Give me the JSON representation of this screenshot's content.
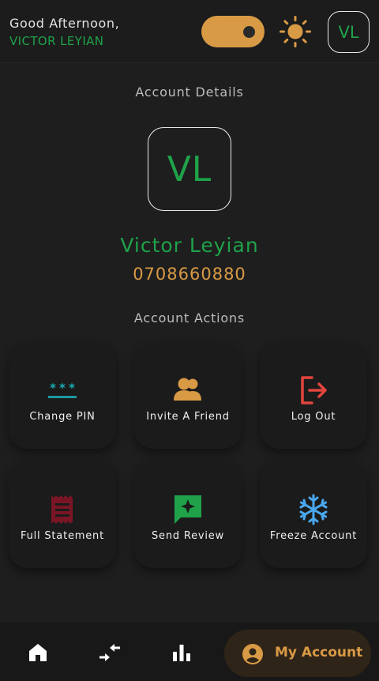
{
  "header": {
    "greeting": "Good Afternoon,",
    "user_name": "VICTOR LEYIAN",
    "avatar_initials": "VL"
  },
  "account": {
    "section_title": "Account Details",
    "avatar_initials": "VL",
    "full_name": "Victor Leyian",
    "phone": "0708660880"
  },
  "actions": {
    "section_title": "Account Actions",
    "items": [
      {
        "label": "Change PIN",
        "icon": "password-icon"
      },
      {
        "label": "Invite A Friend",
        "icon": "group-icon"
      },
      {
        "label": "Log Out",
        "icon": "logout-icon"
      },
      {
        "label": "Full Statement",
        "icon": "receipt-icon"
      },
      {
        "label": "Send Review",
        "icon": "review-icon"
      },
      {
        "label": "Freeze Account",
        "icon": "snowflake-icon"
      }
    ]
  },
  "bottom_nav": {
    "items": [
      {
        "icon": "home-icon"
      },
      {
        "icon": "transfer-icon"
      },
      {
        "icon": "chart-icon"
      }
    ],
    "active_label": "My Account",
    "active_icon": "account-circle-icon"
  },
  "colors": {
    "background": "#1e1e1e",
    "accent_orange": "#d99a45",
    "accent_green": "#1fa24a",
    "teal": "#1a9aa0",
    "red": "#e2453c",
    "maroon": "#7a1526",
    "blue": "#4aa8f0"
  }
}
